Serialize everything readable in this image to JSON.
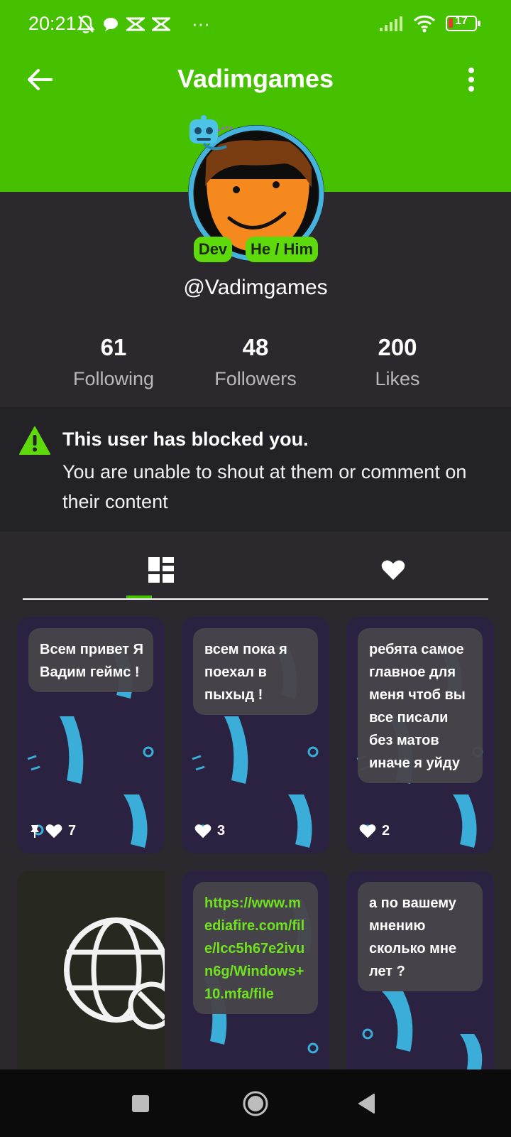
{
  "status_bar": {
    "time": "20:21",
    "dots": "···",
    "battery": "17"
  },
  "app_bar": {
    "title": "Vadimgames"
  },
  "profile": {
    "badges": [
      "Dev",
      "He / Him"
    ],
    "handle": "@Vadimgames",
    "stats": [
      {
        "value": "61",
        "label": "Following"
      },
      {
        "value": "48",
        "label": "Followers"
      },
      {
        "value": "200",
        "label": "Likes"
      }
    ]
  },
  "notice": {
    "title": "This user has blocked you.",
    "body": "You are unable to shout at them or comment on their content"
  },
  "posts": [
    {
      "text": "Всем привет Я Вадим геймс !",
      "likes": "7",
      "pinned": true
    },
    {
      "text": "всем пока я поехал в пыхыд !",
      "likes": "3",
      "pinned": false
    },
    {
      "text": "ребята самое главное для меня чтоб вы все писали без матов иначе я уйду",
      "likes": "2",
      "pinned": false
    },
    {
      "text": "https://www.mediafire.com/file/lcc5h67e2ivun6g/Windows+10.mfa/file",
      "likes": "",
      "pinned": false
    },
    {
      "text": "а по вашему мнению сколько мне лет ?",
      "likes": "",
      "pinned": false
    }
  ],
  "colors": {
    "brand_green": "#45c100",
    "badge_green": "#5dd90c",
    "background": "#2b292e",
    "notice_bg": "#232226",
    "link_green": "#6fe21f"
  }
}
